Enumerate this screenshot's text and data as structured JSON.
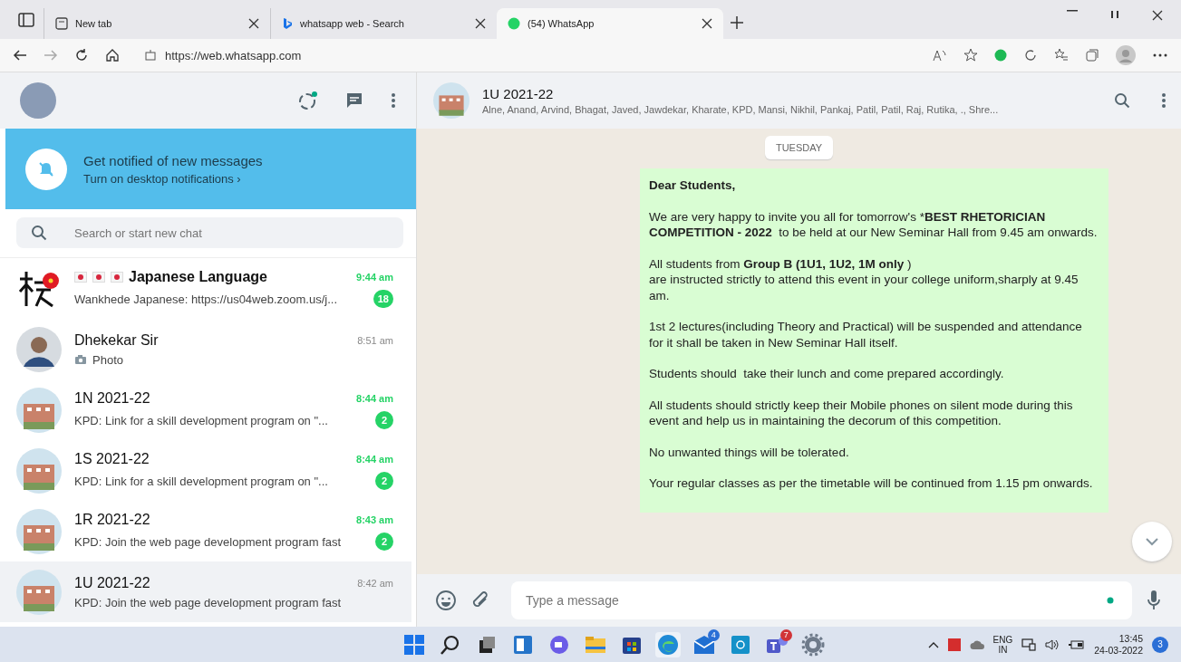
{
  "browser": {
    "tabs": [
      {
        "label": "New tab",
        "selected": false
      },
      {
        "label": "whatsapp web - Search",
        "selected": false
      },
      {
        "label": "(54) WhatsApp",
        "selected": true
      }
    ],
    "url": "https://web.whatsapp.com"
  },
  "notification_banner": {
    "title": "Get notified of new messages",
    "link": "Turn on desktop notifications ›"
  },
  "search": {
    "placeholder": "Search or start new chat"
  },
  "chats": [
    {
      "kind": "flagged",
      "name": "Japanese Language",
      "time": "9:44 am",
      "preview": "Wankhede Japanese: https://us04web.zoom.us/j...",
      "unread": "18",
      "selected": false
    },
    {
      "kind": "photo",
      "name": "Dhekekar Sir",
      "time": "8:51 am",
      "preview": "Photo",
      "selected": false
    },
    {
      "kind": "group",
      "name": "1N 2021-22",
      "time": "8:44 am",
      "preview": "KPD: Link for a skill development program on \"...",
      "unread": "2",
      "selected": false
    },
    {
      "kind": "group",
      "name": "1S 2021-22",
      "time": "8:44 am",
      "preview": "KPD: Link for a skill development program on \"...",
      "unread": "2",
      "selected": false
    },
    {
      "kind": "group",
      "name": "1R 2021-22",
      "time": "8:43 am",
      "preview": "KPD: Join the web page development program fast",
      "unread": "2",
      "selected": false
    },
    {
      "kind": "group",
      "name": "1U 2021-22",
      "time": "8:42 am",
      "preview": "KPD: Join the web page development program fast",
      "selected": true
    }
  ],
  "conversation": {
    "name": "1U 2021-22",
    "members": "Alne, Anand, Arvind, Bhagat, Javed, Jawdekar, Kharate, KPD, Mansi, Nikhil, Pankaj, Patil, Patil, Raj, Rutika, ., Shre...",
    "date_chip": "TUESDAY",
    "message": [
      [
        {
          "text": "Dear Students,",
          "bold": true
        }
      ],
      [
        {
          "text": "We are very happy to invite you all for tomorrow's *"
        },
        {
          "text": "BEST RHETORICIAN COMPETITION - 2022",
          "bold": true
        },
        {
          "text": "  to be held at our New Seminar Hall from 9.45 am onwards."
        }
      ],
      [
        {
          "text": "All students from "
        },
        {
          "text": "Group B (1U1, 1U2, 1M only",
          "bold": true
        },
        {
          "text": " )\nare instructed strictly to attend this event in your college uniform,sharply at 9.45 am."
        }
      ],
      [
        {
          "text": "1st 2 lectures(including Theory and Practical) will be suspended and attendance for it shall be taken in New Seminar Hall itself."
        }
      ],
      [
        {
          "text": "Students should  take their lunch and come prepared accordingly."
        }
      ],
      [
        {
          "text": "All students should strictly keep their Mobile phones on silent mode during this event and help us in maintaining the decorum of this competition."
        }
      ],
      [
        {
          "text": "No unwanted things will be tolerated."
        }
      ],
      [
        {
          "text": "Your regular classes as per the timetable will be continued from 1.15 pm onwards."
        }
      ]
    ],
    "composer": {
      "placeholder": "Type a message"
    }
  },
  "taskbar": {
    "apps": [
      {
        "kind": "start"
      },
      {
        "kind": "search"
      },
      {
        "kind": "taskview"
      },
      {
        "kind": "widgets"
      },
      {
        "kind": "chat"
      },
      {
        "kind": "files"
      },
      {
        "kind": "store"
      },
      {
        "kind": "edge",
        "selected": true
      },
      {
        "kind": "mail",
        "badge": "4"
      },
      {
        "kind": "app"
      },
      {
        "kind": "teams",
        "badge": "7"
      },
      {
        "kind": "settings"
      }
    ],
    "language": "ENG",
    "region": "IN",
    "time": "13:45",
    "date": "24-03-2022",
    "notifications": "3"
  }
}
